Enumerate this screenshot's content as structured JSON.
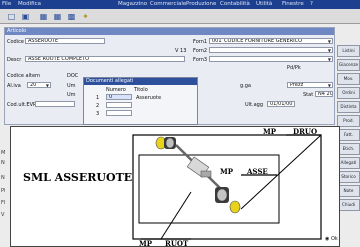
{
  "menu": {
    "left_items": [
      "File",
      "Modifica"
    ],
    "center_items": [
      "Magazzino",
      "Commerciale",
      "Produzione",
      "Contabilità",
      "Utilità",
      "Finestre",
      "?"
    ]
  },
  "form": {
    "title": "Articolo",
    "codice_label": "Codice",
    "codice_value": "ASSERUOTE",
    "forn1_label": "Forn1",
    "forn1_value": "001_CODICE FORNITORE GENERICO",
    "v13_label": "V 13",
    "forn2_label": "Forn2",
    "descr_label": "Descr",
    "descr_value": "ASSE RUOTE COMPLETO",
    "forn3_label": "Forn3",
    "pdpk_label": "Pd/Pk",
    "codice_altern_label": "Codice altern",
    "doc_label": "DOC",
    "aliva_label": "Al.iva",
    "aliva_value": "20",
    "um_label": "Um",
    "um2_label": "Um",
    "prezzo_label": "Prezzo",
    "prezzo_value": "Prezz",
    "ga_label": "g.ga",
    "stat_label": "Stat",
    "stat_value": "N4 20",
    "cod_ult_evr_label": "Cod.ult.EVR",
    "ult_agg_label": "Ult.agg",
    "ult_agg_value": "01/01/00"
  },
  "docs_popup": {
    "title": "Documenti allegati",
    "col_numero": "Numero",
    "col_titolo": "Titolo",
    "rows": [
      {
        "n": "1",
        "numero": "0",
        "titolo": "Asseruote"
      },
      {
        "n": "2",
        "numero": "",
        "titolo": ""
      },
      {
        "n": "3",
        "numero": "",
        "titolo": ""
      }
    ]
  },
  "side_buttons": [
    "Listini",
    "Giacenze",
    "Mov.",
    "Ordini",
    "Distinta",
    "Prod.",
    "Fatt.",
    "Etich.",
    "Allegati",
    "Storico",
    "Note",
    "Chiudi"
  ],
  "drawing": {
    "title": "SML ASSERUOTE",
    "label_mp_druo": "MP",
    "label_druo": "DRUO",
    "label_mp_asse": "MP",
    "label_asse": "ASSE",
    "label_mp_ruot": "MP",
    "label_ruot": "RUOT"
  },
  "gutter": [
    "M",
    "N",
    "N",
    "Pl",
    "Fl",
    "V"
  ],
  "bottom_right": "Ok",
  "colors": {
    "menubar": "#1c3f8f",
    "form_title": "#6f88c4",
    "popup_title": "#2d4f9c",
    "wheel_yellow": "#e8d21a"
  }
}
